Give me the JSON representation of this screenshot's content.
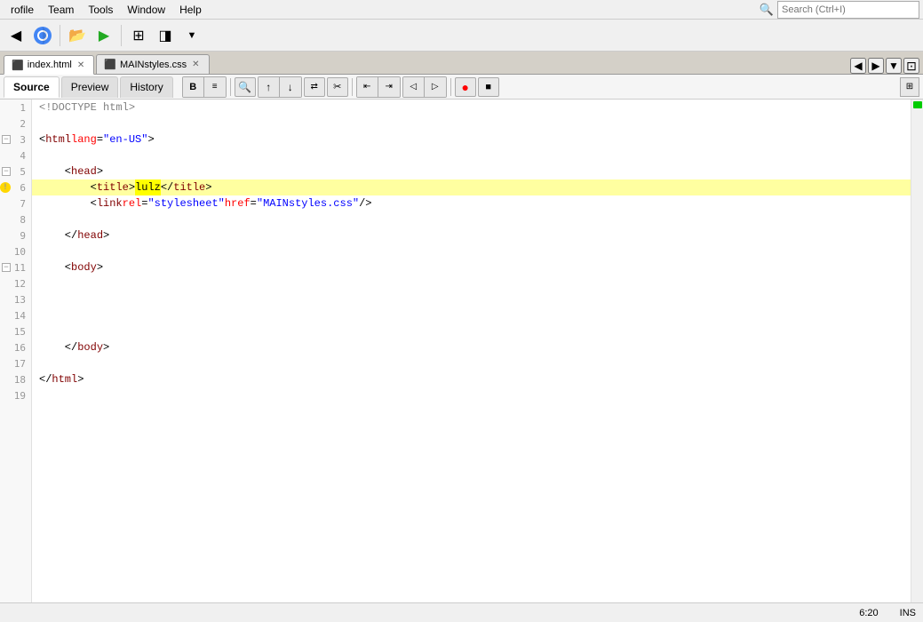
{
  "menubar": {
    "items": [
      "rofile",
      "Team",
      "Tools",
      "Window",
      "Help"
    ]
  },
  "toolbar": {
    "search_placeholder": "Search (Ctrl+I)"
  },
  "tabs": [
    {
      "label": "index.html",
      "icon": "html-icon",
      "active": true
    },
    {
      "label": "MAINstyles.css",
      "icon": "css-icon",
      "active": false
    }
  ],
  "viewtabs": {
    "tabs": [
      "Source",
      "Preview",
      "History"
    ],
    "active": "Source"
  },
  "editor": {
    "lines": [
      {
        "num": 1,
        "content": "<!DOCTYPE html>",
        "type": "doctype"
      },
      {
        "num": 2,
        "content": "",
        "type": "empty"
      },
      {
        "num": 3,
        "content": "<html lang=\"en-US\">",
        "type": "tag",
        "fold": true
      },
      {
        "num": 4,
        "content": "",
        "type": "empty"
      },
      {
        "num": 5,
        "content": "    <head>",
        "type": "tag",
        "fold": true
      },
      {
        "num": 6,
        "content": "        <title>lulz</title>",
        "type": "tag",
        "highlighted": true,
        "warn": true
      },
      {
        "num": 7,
        "content": "        <link rel=\"stylesheet\" href=\"MAINstyles.css\"/>",
        "type": "tag"
      },
      {
        "num": 8,
        "content": "",
        "type": "empty"
      },
      {
        "num": 9,
        "content": "    </head>",
        "type": "tag"
      },
      {
        "num": 10,
        "content": "",
        "type": "empty"
      },
      {
        "num": 11,
        "content": "    <body>",
        "type": "tag",
        "fold": true
      },
      {
        "num": 12,
        "content": "",
        "type": "empty"
      },
      {
        "num": 13,
        "content": "",
        "type": "empty"
      },
      {
        "num": 14,
        "content": "",
        "type": "empty"
      },
      {
        "num": 15,
        "content": "",
        "type": "empty"
      },
      {
        "num": 16,
        "content": "    </body>",
        "type": "tag"
      },
      {
        "num": 17,
        "content": "",
        "type": "empty"
      },
      {
        "num": 18,
        "content": "</html>",
        "type": "tag"
      },
      {
        "num": 19,
        "content": "",
        "type": "empty"
      }
    ]
  },
  "statusbar": {
    "position": "6:20",
    "mode": "INS"
  }
}
